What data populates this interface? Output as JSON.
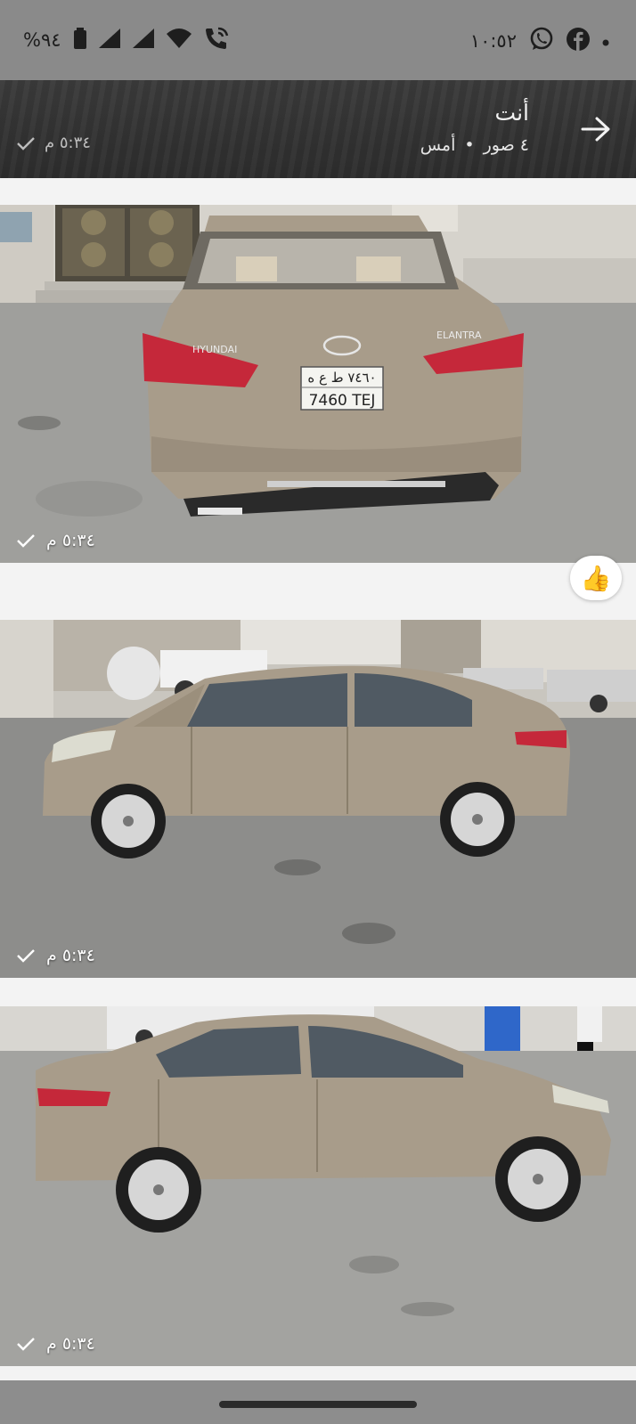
{
  "status_bar": {
    "time": "١٠:٥٢",
    "battery": "%٩٤",
    "icons": [
      "battery-icon",
      "signal-icon",
      "signal-icon-2",
      "wifi-icon",
      "wifi-call-icon",
      "dot-icon",
      "facebook-icon",
      "whatsapp-icon"
    ]
  },
  "header": {
    "title": "أنت",
    "photo_count": "٤ صور",
    "separator": "•",
    "date": "أمس",
    "time": "٥:٣٤ م"
  },
  "photos": [
    {
      "time": "٥:٣٤ م",
      "plate_top": "٧٤٦٠ ط ع ه",
      "plate_bottom": "7460 TEJ",
      "badge_model": "ELANTRA",
      "badge_brand": "HYUNDAI"
    },
    {
      "time": "٥:٣٤ م"
    },
    {
      "time": "٥:٣٤ م"
    }
  ],
  "reaction": "👍",
  "colors": {
    "status_bar": "#8a8a8a",
    "header": "#323232",
    "car": "#a89c8a",
    "nav_bar": "#8d8d8d"
  }
}
